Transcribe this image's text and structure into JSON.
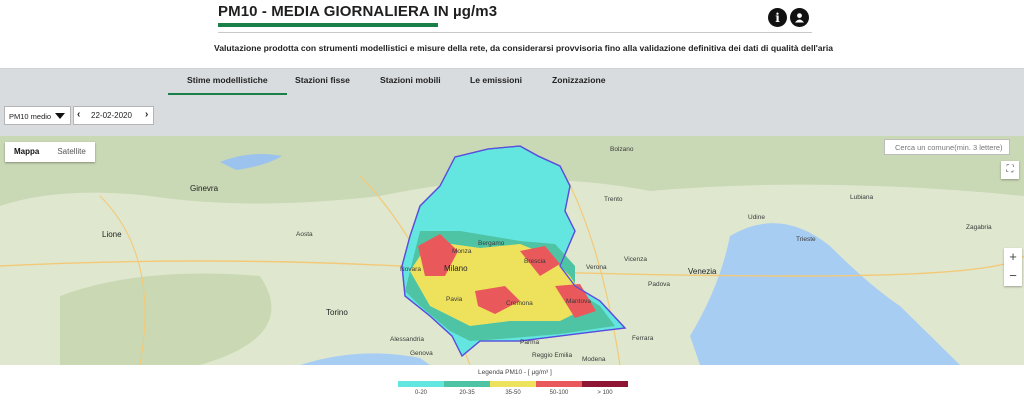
{
  "header": {
    "title": "PM10 - MEDIA GIORNALIERA IN µg/m3",
    "subtitle": "Valutazione prodotta con strumenti modellistici e misure della rete, da considerarsi provvisoria fino alla validazione definitiva dei dati di qualità dell'aria",
    "info_icon": "info-icon",
    "user_icon": "user-icon",
    "accent": "#1b7f4a"
  },
  "tabs": [
    {
      "label": "Stime modellistiche",
      "active": true
    },
    {
      "label": "Stazioni fisse",
      "active": false
    },
    {
      "label": "Stazioni mobili",
      "active": false
    },
    {
      "label": "Le emissioni",
      "active": false
    },
    {
      "label": "Zonizzazione",
      "active": false
    }
  ],
  "controls": {
    "metric_selected": "PM10 medio",
    "date": "22-02-2020"
  },
  "map": {
    "type_buttons": [
      "Mappa",
      "Satellite"
    ],
    "search_placeholder": "Cerca un comune(min. 3 lettere)",
    "zoom_in": "+",
    "zoom_out": "−",
    "cities": [
      "Milano",
      "Bergamo",
      "Brescia",
      "Monza",
      "Pavia",
      "Cremona",
      "Mantova",
      "Torino",
      "Genova",
      "Verona",
      "Venezia",
      "Padova",
      "Trento",
      "Bolzano",
      "Lubiana",
      "Zagabria",
      "Ginevra",
      "Lione",
      "Parma",
      "Modena",
      "Reggio Emilia",
      "Ferrara",
      "Vicenza",
      "Udine",
      "Trieste",
      "Novara",
      "Alessandria",
      "Aosta"
    ]
  },
  "legend": {
    "title": "Legenda PM10 - [ µg/m³ ]",
    "classes": [
      {
        "label": "0-20",
        "color": "#63e6e0"
      },
      {
        "label": "20-35",
        "color": "#4fc4a4"
      },
      {
        "label": "35-50",
        "color": "#eee15c"
      },
      {
        "label": "50-100",
        "color": "#e9595b"
      },
      {
        "label": "> 100",
        "color": "#8f1535"
      }
    ]
  }
}
